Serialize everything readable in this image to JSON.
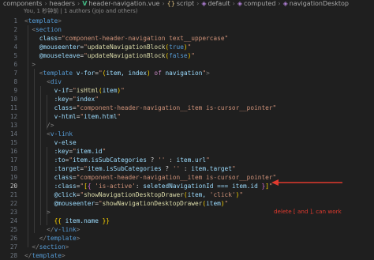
{
  "breadcrumb": {
    "items": [
      "components",
      "headers",
      "header-navigation.vue",
      "script",
      "default",
      "computed",
      "navigationDesktop"
    ]
  },
  "blame": "You, 1 秒钟前 | 1 authors (jojo and others)",
  "code": {
    "lines": [
      {
        "n": "1",
        "tokens": [
          [
            "<",
            "p"
          ],
          [
            "template",
            "tag"
          ],
          [
            ">",
            "p"
          ]
        ]
      },
      {
        "n": "2",
        "tokens": [
          [
            "  ",
            ""
          ],
          [
            "<",
            "p"
          ],
          [
            "section",
            "tag"
          ]
        ]
      },
      {
        "n": "3",
        "tokens": [
          [
            "    ",
            ""
          ],
          [
            "class",
            "attr"
          ],
          [
            "=",
            "w"
          ],
          [
            "\"component-header-navigation text__uppercase\"",
            "str"
          ]
        ]
      },
      {
        "n": "4",
        "tokens": [
          [
            "    ",
            ""
          ],
          [
            "@mouseenter",
            "attr"
          ],
          [
            "=",
            "w"
          ],
          [
            "\"",
            "str"
          ],
          [
            "updateNavigationBlock",
            "fn"
          ],
          [
            "(",
            "yellow"
          ],
          [
            "true",
            "tag"
          ],
          [
            ")",
            "yellow"
          ],
          [
            "\"",
            "str"
          ]
        ]
      },
      {
        "n": "5",
        "tokens": [
          [
            "    ",
            ""
          ],
          [
            "@mouseleave",
            "attr"
          ],
          [
            "=",
            "w"
          ],
          [
            "\"",
            "str"
          ],
          [
            "updateNavigationBlock",
            "fn"
          ],
          [
            "(",
            "yellow"
          ],
          [
            "false",
            "tag"
          ],
          [
            ")",
            "yellow"
          ],
          [
            "\"",
            "str"
          ]
        ]
      },
      {
        "n": "6",
        "tokens": [
          [
            "  ",
            ""
          ],
          [
            ">",
            "p"
          ]
        ]
      },
      {
        "n": "7",
        "tokens": [
          [
            "    ",
            ""
          ],
          [
            "<",
            "p"
          ],
          [
            "template",
            "tag"
          ],
          [
            " ",
            ""
          ],
          [
            "v-for",
            "attr"
          ],
          [
            "=",
            "w"
          ],
          [
            "\"",
            "str"
          ],
          [
            "(",
            "yellow"
          ],
          [
            "item, index",
            "var"
          ],
          [
            ")",
            "yellow"
          ],
          [
            " ",
            ""
          ],
          [
            "of",
            "kw"
          ],
          [
            " ",
            ""
          ],
          [
            "navigation",
            "var"
          ],
          [
            "\"",
            "str"
          ],
          [
            ">",
            "p"
          ]
        ]
      },
      {
        "n": "8",
        "tokens": [
          [
            "      ",
            ""
          ],
          [
            "<",
            "p"
          ],
          [
            "div",
            "tag"
          ]
        ]
      },
      {
        "n": "9",
        "tokens": [
          [
            "        ",
            ""
          ],
          [
            "v-if",
            "attr"
          ],
          [
            "=",
            "w"
          ],
          [
            "\"",
            "str"
          ],
          [
            "isHtml",
            "fn"
          ],
          [
            "(",
            "yellow"
          ],
          [
            "item",
            "var"
          ],
          [
            ")",
            "yellow"
          ],
          [
            "\"",
            "str"
          ]
        ]
      },
      {
        "n": "10",
        "tokens": [
          [
            "        ",
            ""
          ],
          [
            ":key",
            "attr"
          ],
          [
            "=",
            "w"
          ],
          [
            "\"",
            "str"
          ],
          [
            "index",
            "var"
          ],
          [
            "\"",
            "str"
          ]
        ]
      },
      {
        "n": "11",
        "tokens": [
          [
            "        ",
            ""
          ],
          [
            "class",
            "attr"
          ],
          [
            "=",
            "w"
          ],
          [
            "\"component-header-navigation__item is-cursor__pointer\"",
            "str"
          ]
        ]
      },
      {
        "n": "12",
        "tokens": [
          [
            "        ",
            ""
          ],
          [
            "v-html",
            "attr"
          ],
          [
            "=",
            "w"
          ],
          [
            "\"",
            "str"
          ],
          [
            "item.html",
            "var"
          ],
          [
            "\"",
            "str"
          ]
        ]
      },
      {
        "n": "13",
        "tokens": [
          [
            "      ",
            ""
          ],
          [
            "/>",
            "p"
          ]
        ]
      },
      {
        "n": "14",
        "tokens": [
          [
            "      ",
            ""
          ],
          [
            "<",
            "p"
          ],
          [
            "v-link",
            "tag"
          ]
        ]
      },
      {
        "n": "15",
        "tokens": [
          [
            "        ",
            ""
          ],
          [
            "v-else",
            "attr"
          ]
        ]
      },
      {
        "n": "16",
        "tokens": [
          [
            "        ",
            ""
          ],
          [
            ":key",
            "attr"
          ],
          [
            "=",
            "w"
          ],
          [
            "\"",
            "str"
          ],
          [
            "item.id",
            "var"
          ],
          [
            "\"",
            "str"
          ]
        ]
      },
      {
        "n": "17",
        "tokens": [
          [
            "        ",
            ""
          ],
          [
            ":to",
            "attr"
          ],
          [
            "=",
            "w"
          ],
          [
            "\"",
            "str"
          ],
          [
            "item.isSubCategories",
            "var"
          ],
          [
            " ? ",
            "w"
          ],
          [
            "''",
            "str"
          ],
          [
            " : ",
            "w"
          ],
          [
            "item.url",
            "var"
          ],
          [
            "\"",
            "str"
          ]
        ]
      },
      {
        "n": "18",
        "tokens": [
          [
            "        ",
            ""
          ],
          [
            ":target",
            "attr"
          ],
          [
            "=",
            "w"
          ],
          [
            "\"",
            "str"
          ],
          [
            "item.isSubCategories",
            "var"
          ],
          [
            " ? ",
            "w"
          ],
          [
            "''",
            "str"
          ],
          [
            " : ",
            "w"
          ],
          [
            "item.target",
            "var"
          ],
          [
            "\"",
            "str"
          ]
        ]
      },
      {
        "n": "19",
        "tokens": [
          [
            "        ",
            ""
          ],
          [
            "class",
            "attr"
          ],
          [
            "=",
            "w"
          ],
          [
            "\"component-header-navigation__item is-cursor__pointer\"",
            "str"
          ]
        ]
      },
      {
        "n": "20",
        "tokens": [
          [
            "        ",
            ""
          ],
          [
            ":class",
            "attr"
          ],
          [
            "=",
            "w"
          ],
          [
            "\"",
            "str"
          ],
          [
            "[",
            "yellow"
          ],
          [
            "{",
            "pink"
          ],
          [
            " ",
            ""
          ],
          [
            "'is-active'",
            "str"
          ],
          [
            ": ",
            "w"
          ],
          [
            "seletedNavigationId === item.id",
            "var"
          ],
          [
            " ",
            ""
          ],
          [
            "}",
            "pink"
          ],
          [
            "]",
            "yellow"
          ],
          [
            "\"",
            "str"
          ]
        ],
        "active": true
      },
      {
        "n": "21",
        "tokens": [
          [
            "        ",
            ""
          ],
          [
            "@click",
            "attr"
          ],
          [
            "=",
            "w"
          ],
          [
            "\"",
            "str"
          ],
          [
            "showNavigationDesktopDrawer",
            "fn"
          ],
          [
            "(",
            "yellow"
          ],
          [
            "item, ",
            "var"
          ],
          [
            "'click'",
            "str"
          ],
          [
            ")",
            "yellow"
          ],
          [
            "\"",
            "str"
          ]
        ]
      },
      {
        "n": "22",
        "tokens": [
          [
            "        ",
            ""
          ],
          [
            "@mouseenter",
            "attr"
          ],
          [
            "=",
            "w"
          ],
          [
            "\"",
            "str"
          ],
          [
            "showNavigationDesktopDrawer",
            "fn"
          ],
          [
            "(",
            "yellow"
          ],
          [
            "item",
            "var"
          ],
          [
            ")",
            "yellow"
          ],
          [
            "\"",
            "str"
          ]
        ]
      },
      {
        "n": "23",
        "tokens": [
          [
            "      ",
            ""
          ],
          [
            ">",
            "p"
          ]
        ]
      },
      {
        "n": "24",
        "tokens": [
          [
            "        ",
            ""
          ],
          [
            "{{",
            "yellow"
          ],
          [
            " item.name ",
            "var"
          ],
          [
            "}}",
            "yellow"
          ]
        ]
      },
      {
        "n": "25",
        "tokens": [
          [
            "      ",
            ""
          ],
          [
            "</",
            "p"
          ],
          [
            "v-link",
            "tag"
          ],
          [
            ">",
            "p"
          ]
        ]
      },
      {
        "n": "26",
        "tokens": [
          [
            "    ",
            ""
          ],
          [
            "</",
            "p"
          ],
          [
            "template",
            "tag"
          ],
          [
            ">",
            "p"
          ]
        ]
      },
      {
        "n": "27",
        "tokens": [
          [
            "  ",
            ""
          ],
          [
            "</",
            "p"
          ],
          [
            "section",
            "tag"
          ],
          [
            ">",
            "p"
          ]
        ]
      },
      {
        "n": "28",
        "tokens": [
          [
            "</",
            "p"
          ],
          [
            "template",
            "tag"
          ],
          [
            ">",
            "p"
          ]
        ]
      }
    ]
  },
  "annotation": {
    "text": "delete [ and ], can work",
    "color": "#e03a2e"
  },
  "colors": {
    "background": "#1f1f1f",
    "tag": "#569cd6",
    "attribute": "#9cdcfe",
    "string": "#ce9178",
    "keyword": "#c586c0",
    "function": "#dcdcaa"
  }
}
